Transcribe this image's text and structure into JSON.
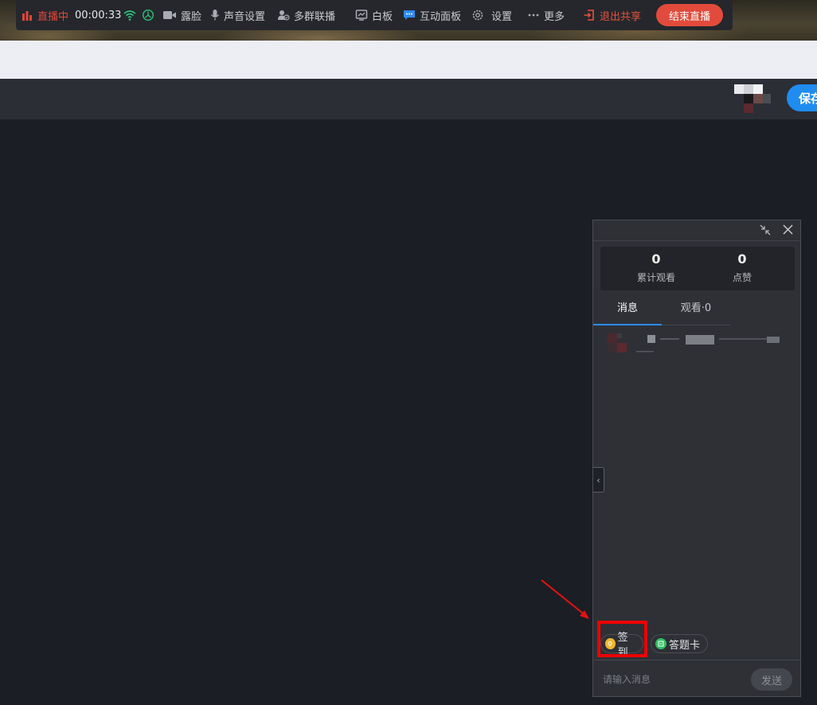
{
  "toolbar": {
    "live_label": "直播中",
    "timer": "00:00:33",
    "face_label": "露脸",
    "audio_label": "声音设置",
    "multigroup_label": "多群联播",
    "whiteboard_label": "白板",
    "interactive_label": "互动面板",
    "settings_label": "设置",
    "more_label": "更多",
    "exit_share_label": "退出共享",
    "end_live_label": "结束直播"
  },
  "header": {
    "save_label": "保存"
  },
  "panel": {
    "stats": [
      {
        "value": "0",
        "label": "累计观看"
      },
      {
        "value": "0",
        "label": "点赞"
      }
    ],
    "tabs": [
      {
        "label": "消息",
        "active": true
      },
      {
        "label": "观看·0",
        "active": false
      }
    ],
    "tools": {
      "signin_label": "签到",
      "answer_card_label": "答题卡"
    },
    "input": {
      "placeholder": "请输入消息",
      "send_label": "发送"
    }
  },
  "colors": {
    "live_red": "#e0473a",
    "accent_blue": "#1f8cf0",
    "end_button": "#e24b3b",
    "highlight": "#ee0000"
  },
  "icons": [
    "live-bars-icon",
    "wifi-icon",
    "cpu-gauge-icon",
    "camera-icon",
    "mic-icon",
    "users-icon",
    "whiteboard-icon",
    "chat-panel-icon",
    "gear-icon",
    "more-dots-icon",
    "exit-icon",
    "collapse-icon",
    "close-icon",
    "chevron-left-icon",
    "signin-icon",
    "answer-card-icon",
    "red-arrow"
  ]
}
